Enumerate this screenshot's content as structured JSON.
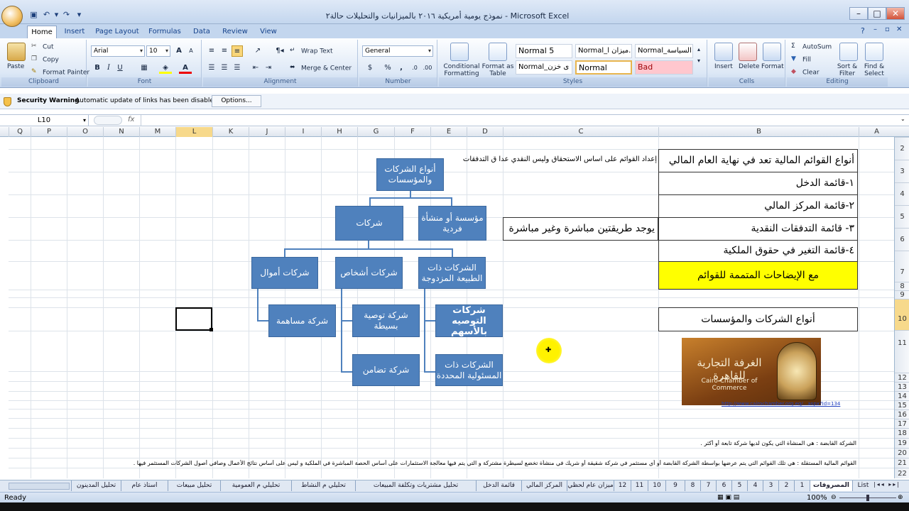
{
  "window": {
    "title": "نموذج يومية أمريكية ٢٠١٦ بالميزانيات والتحليلات حالة٢ - Microsoft Excel",
    "controls": {
      "minimize": "–",
      "maximize": "□",
      "close": "✕"
    }
  },
  "tabs": [
    "Home",
    "Insert",
    "Page Layout",
    "Formulas",
    "Data",
    "Review",
    "View"
  ],
  "ribbon": {
    "clipboard": {
      "paste": "Paste",
      "cut": "Cut",
      "copy": "Copy",
      "format_painter": "Format Painter",
      "label": "Clipboard"
    },
    "font": {
      "name": "Arial",
      "size": "10",
      "bold": "B",
      "italic": "I",
      "underline": "U",
      "grow": "A",
      "shrink": "A",
      "label": "Font"
    },
    "alignment": {
      "wrap_text": "Wrap Text",
      "merge_center": "Merge & Center",
      "label": "Alignment"
    },
    "number": {
      "format": "General",
      "dollar": "$",
      "percent": "%",
      "comma": ",",
      "label": "Number"
    },
    "styles": {
      "conditional": "Conditional Formatting",
      "format_table": "Format as Table",
      "cells": [
        "Normal 5",
        "Normal_ميزان ا...",
        "Normal_ى السياسة",
        "Normal_ى خزن",
        "Normal",
        "Bad"
      ],
      "label": "Styles"
    },
    "cells": {
      "insert": "Insert",
      "delete": "Delete",
      "format": "Format",
      "label": "Cells"
    },
    "editing": {
      "autosum": "AutoSum",
      "fill": "Fill",
      "clear": "Clear",
      "sort_filter": "Sort & Filter",
      "find_select": "Find & Select",
      "label": "Editing"
    }
  },
  "security": {
    "title": "Security Warning",
    "message": "Automatic update of links has been disabled",
    "options": "Options..."
  },
  "formula_bar": {
    "name_box": "L10",
    "fx": "fx",
    "formula": ""
  },
  "columns": [
    "Q",
    "P",
    "O",
    "N",
    "M",
    "L",
    "K",
    "J",
    "I",
    "H",
    "G",
    "F",
    "E",
    "D",
    "C",
    "B",
    "A"
  ],
  "rows": [
    "2",
    "3",
    "4",
    "5",
    "6",
    "7",
    "8",
    "9",
    "10",
    "11",
    "12",
    "13",
    "14",
    "15",
    "16",
    "17",
    "18",
    "19",
    "20",
    "21",
    "22"
  ],
  "cells": {
    "b2": "أنواع القوائم المالية تعد في نهاية العام المالي",
    "c2": "إعداد القوائم على اساس الاستحقاق وليس النقدي عدا ق التدفقات",
    "b3": "١-قائمة الدخل",
    "b4": "٢-قائمة المركز المالي",
    "b5": "٣- قائمة التدفقات النقدية",
    "c5": "يوجد طريقتين مباشرة وغير مباشرة",
    "b6": "٤-قائمة التغير في حقوق الملكية",
    "b7": "مع الإيضاحات المتممة للقوائم",
    "b10": "أنواع الشركات والمؤسسات",
    "link15": "http://www.cairochamber.org.eg/...aspx?Id=134",
    "row19": "الشركة القابضة : هي المنشأة التي يكون لديها شركة تابعة أو أكثر .",
    "row21": "القوائم المالية المستقلة : هي تلك القوائم التي يتم عرضها بواسطة الشركة القابضة أو أي مستثمر في شركة شقيقة أو شريك في منشأة تخضع لسيطرة مشتركة و التي يتم فيها معالجة الاستثمارات على أساس الحصة المباشرة في الملكية و ليس على أساس نتائج الأعمال وصافي أصول الشركات المستثمر فيها ."
  },
  "logo": {
    "arabic": "الغرفة التجارية للقاهرة",
    "english": "Cairo Chamber of Commerce"
  },
  "smartart": {
    "root": "أنواع الشركات والمؤسسات",
    "companies": "شركات",
    "sole": "مؤسسة أو منشأة فردية",
    "capital": "شركات أموال",
    "persons": "شركات أشخاص",
    "mixed": "الشركات ذات الطبيعة المزدوجة",
    "shareholding": "شركة مساهمة",
    "simple_partnership": "شركة توصية بسيطة",
    "general_partnership": "شركة تضامن",
    "share_partnership": "شركات التوصيه بالأسهم",
    "limited_liability": "الشركات ذات المسئولية المحددة"
  },
  "sheet_tabs": [
    "List",
    "المصروفات",
    "1",
    "2",
    "3",
    "4",
    "5",
    "6",
    "7",
    "8",
    "9",
    "10",
    "11",
    "12",
    "ميزان عام لحظي",
    "المركز المالي",
    "قائمة الدخل",
    "تحليل مشتريات وتكلفة المبيعات",
    "تحليلي م النشاط",
    "تحليلي م العمومية",
    "تحليل مبيعات",
    "استاذ عام",
    "تحليل المدينون"
  ],
  "status": {
    "ready": "Ready",
    "zoom": "100%"
  }
}
